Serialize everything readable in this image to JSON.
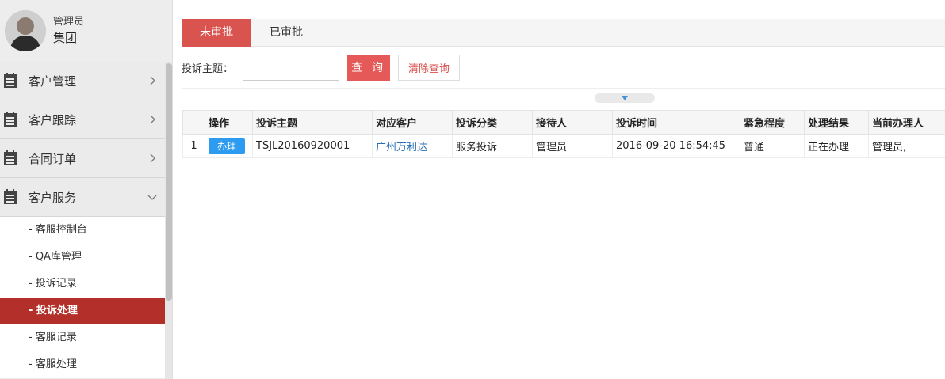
{
  "profile": {
    "role": "管理员",
    "org": "集团"
  },
  "sidebar": {
    "menus": [
      {
        "label": "客户管理",
        "icon": "list-icon",
        "expanded": false
      },
      {
        "label": "客户跟踪",
        "icon": "list-icon",
        "expanded": false
      },
      {
        "label": "合同订单",
        "icon": "list-icon",
        "expanded": false
      },
      {
        "label": "客户服务",
        "icon": "list-icon",
        "expanded": true
      }
    ],
    "submenu": [
      {
        "label": "- 客服控制台"
      },
      {
        "label": "- QA库管理"
      },
      {
        "label": "- 投诉记录"
      },
      {
        "label": "- 投诉处理",
        "active": true
      },
      {
        "label": "- 客服记录"
      },
      {
        "label": "- 客服处理"
      }
    ]
  },
  "tabs": [
    {
      "label": "未审批",
      "active": true
    },
    {
      "label": "已审批",
      "active": false
    }
  ],
  "filter": {
    "label": "投诉主题：",
    "value": "",
    "query_label": "查 询",
    "clear_label": "清除查询"
  },
  "table": {
    "columns": [
      "",
      "操作",
      "投诉主题",
      "对应客户",
      "投诉分类",
      "接待人",
      "投诉时间",
      "紧急程度",
      "处理结果",
      "当前办理人"
    ],
    "rows": [
      {
        "num": "1",
        "action": "办理",
        "subject": "TSJL20160920001",
        "customer": "广州万利达",
        "category": "服务投诉",
        "receiver": "管理员",
        "time": "2016-09-20 16:54:45",
        "urgency": "普通",
        "result": "正在办理",
        "handler": "管理员,"
      }
    ]
  },
  "colors": {
    "accent_red": "#d9534f",
    "active_sub": "#b3302a",
    "blue_button": "#2d9cf0",
    "link": "#2a6fb5"
  }
}
